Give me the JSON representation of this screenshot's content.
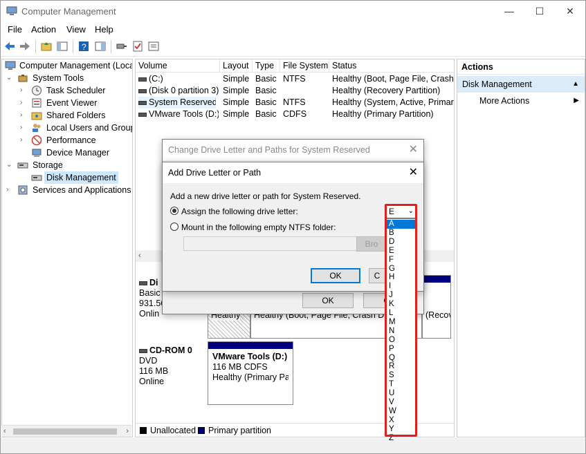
{
  "window": {
    "title": "Computer Management",
    "minimize": "—",
    "maximize": "☐",
    "close": "✕"
  },
  "menu": [
    "File",
    "Action",
    "View",
    "Help"
  ],
  "tree": {
    "root": "Computer Management (Local",
    "system_tools": "System Tools",
    "task_scheduler": "Task Scheduler",
    "event_viewer": "Event Viewer",
    "shared_folders": "Shared Folders",
    "local_users": "Local Users and Groups",
    "performance": "Performance",
    "device_manager": "Device Manager",
    "storage": "Storage",
    "disk_management": "Disk Management",
    "services": "Services and Applications"
  },
  "volumes": {
    "headers": [
      "Volume",
      "Layout",
      "Type",
      "File System",
      "Status"
    ],
    "rows": [
      [
        "(C:)",
        "Simple",
        "Basic",
        "NTFS",
        "Healthy (Boot, Page File, Crash D"
      ],
      [
        "(Disk 0 partition 3)",
        "Simple",
        "Basic",
        "",
        "Healthy (Recovery Partition)"
      ],
      [
        "System Reserved",
        "Simple",
        "Basic",
        "NTFS",
        "Healthy (System, Active, Primary"
      ],
      [
        "VMware Tools (D:)",
        "Simple",
        "Basic",
        "CDFS",
        "Healthy (Primary Partition)"
      ]
    ]
  },
  "disks": {
    "disk0_name": "Di",
    "disk0_type": "Basic",
    "disk0_size": "931.56",
    "disk0_status": "Onlin",
    "disk0_part_status": "Healthy",
    "disk0_part2_status": "Healthy (Boot, Page File, Crash Dun",
    "disk0_part3_status": "(Recov",
    "cd_name": "CD-ROM 0",
    "cd_type": "DVD",
    "cd_size": "116 MB",
    "cd_status": "Online",
    "cd_part_name": "VMware Tools  (D:)",
    "cd_part_size": "116 MB CDFS",
    "cd_part_status": "Healthy (Primary Pa"
  },
  "legend": {
    "unallocated": "Unallocated",
    "primary": "Primary partition"
  },
  "actions": {
    "title": "Actions",
    "section": "Disk Management",
    "more": "More Actions"
  },
  "dialog_back": {
    "title": "Change Drive Letter and Paths for System Reserved",
    "ok": "OK",
    "cancel": "Ca"
  },
  "dialog_front": {
    "title": "Add Drive Letter or Path",
    "description": "Add a new drive letter or path for System Reserved.",
    "assign_label": "Assign the following drive letter:",
    "mount_label": "Mount in the following empty NTFS folder:",
    "browse": "Bro",
    "ok": "OK",
    "cancel": "C",
    "selected_letter": "E",
    "letters": [
      "A",
      "B",
      "D",
      "E",
      "F",
      "G",
      "H",
      "I",
      "J",
      "K",
      "L",
      "M",
      "N",
      "O",
      "P",
      "Q",
      "R",
      "S",
      "T",
      "U",
      "V",
      "W",
      "X",
      "Y",
      "Z"
    ]
  },
  "colors": {
    "primary_partition": "#00007f",
    "highlight": "#0078d7",
    "annotation": "#e0201b"
  }
}
